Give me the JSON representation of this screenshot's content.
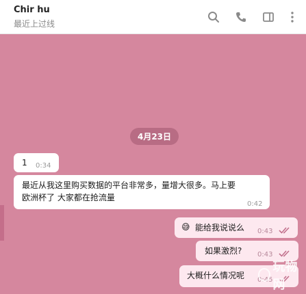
{
  "header": {
    "contact_name": "Chir hu",
    "status": "最近上过线",
    "icons": [
      "search-icon",
      "phone-icon",
      "sidebar-toggle-icon",
      "more-vertical-icon"
    ]
  },
  "chat": {
    "date_label": "4月23日",
    "messages": [
      {
        "direction": "in",
        "text": "1",
        "time": "0:34"
      },
      {
        "direction": "in",
        "text_line1": "最近从我这里购买数据的平台非常多，量增大很多。马上要",
        "text_line2": "欧洲杯了 大家都在抢流量",
        "time": "0:42"
      },
      {
        "direction": "out",
        "emoji": "😅",
        "text": "能给我说说么",
        "time": "0:43",
        "status": "read"
      },
      {
        "direction": "out",
        "text": "如果激烈?",
        "time": "0:43",
        "status": "read"
      },
      {
        "direction": "out",
        "text": "大概什么情况呢",
        "time": "0:45",
        "status": "read"
      }
    ]
  },
  "watermark": {
    "text": "玩物网"
  },
  "colors": {
    "chat_background": "#d5879e",
    "outgoing_bubble": "#fde8ef",
    "incoming_bubble": "#ffffff",
    "read_check": "#c2708c",
    "date_pill": "#b86c84"
  }
}
